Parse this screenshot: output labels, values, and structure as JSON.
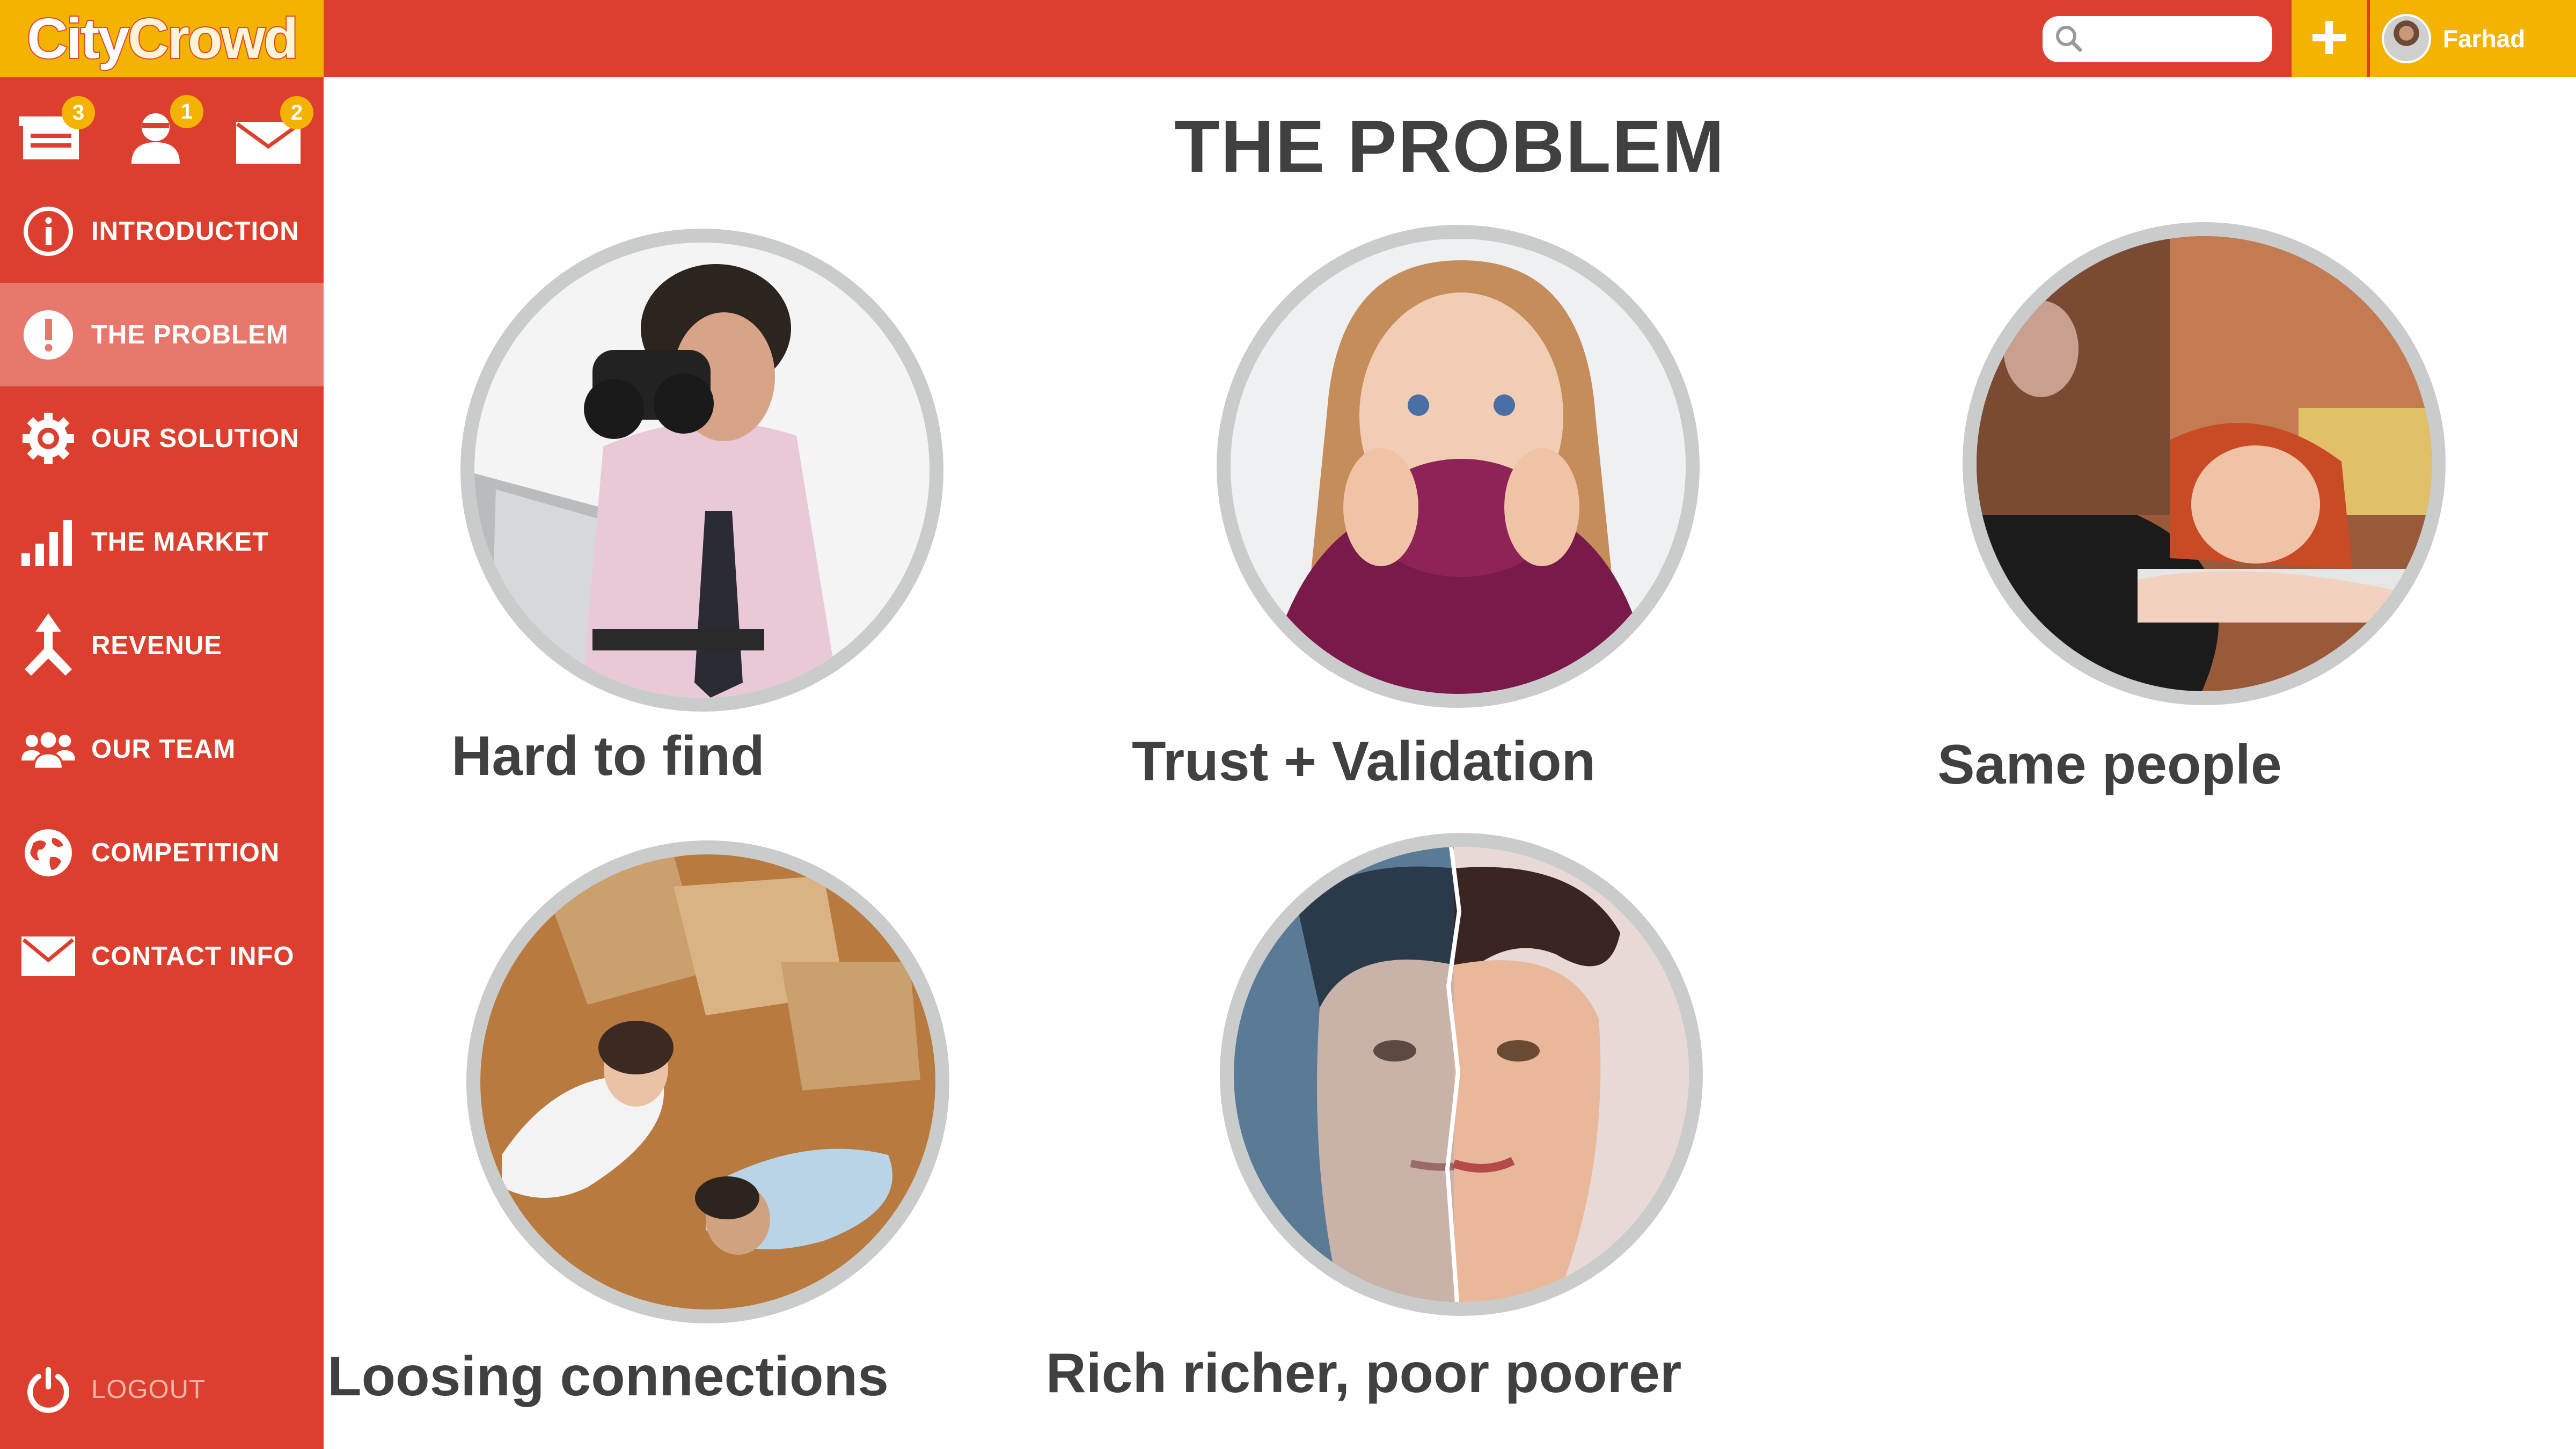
{
  "app": {
    "logo_part1": "City",
    "logo_part2": "Crowd"
  },
  "header": {
    "search_placeholder": "",
    "user_name": "Farhad"
  },
  "notifications": [
    {
      "icon": "inbox-icon",
      "count": "3"
    },
    {
      "icon": "user-request-icon",
      "count": "1"
    },
    {
      "icon": "mail-icon",
      "count": "2"
    }
  ],
  "sidebar": {
    "items": [
      {
        "label": "INTRODUCTION",
        "icon": "info-icon"
      },
      {
        "label": "THE PROBLEM",
        "icon": "exclamation-icon"
      },
      {
        "label": "OUR SOLUTION",
        "icon": "gear-icon"
      },
      {
        "label": "THE MARKET",
        "icon": "bar-chart-icon"
      },
      {
        "label": "REVENUE",
        "icon": "merge-arrows-icon"
      },
      {
        "label": "OUR TEAM",
        "icon": "team-icon"
      },
      {
        "label": "COMPETITION",
        "icon": "globe-icon"
      },
      {
        "label": "CONTACT INFO",
        "icon": "envelope-icon"
      }
    ],
    "active_index": 1,
    "logout_label": "LOGOUT"
  },
  "main": {
    "title": "THE PROBLEM",
    "cards": [
      {
        "label": "Hard to find",
        "image": "man-with-binoculars-photo"
      },
      {
        "label": "Trust + Validation",
        "image": "worried-woman-photo"
      },
      {
        "label": "Same people",
        "image": "bored-woman-at-party-photo"
      },
      {
        "label": "Loosing connections",
        "image": "couple-lying-on-floor-photo"
      },
      {
        "label": "Rich richer, poor poorer",
        "image": "split-face-photo"
      }
    ]
  },
  "colors": {
    "primary_red": "#dc3f2e",
    "accent_yellow": "#f5b301",
    "active_item": "#e8786b",
    "text_dark": "#404040",
    "circle_border": "#c9ccca"
  }
}
